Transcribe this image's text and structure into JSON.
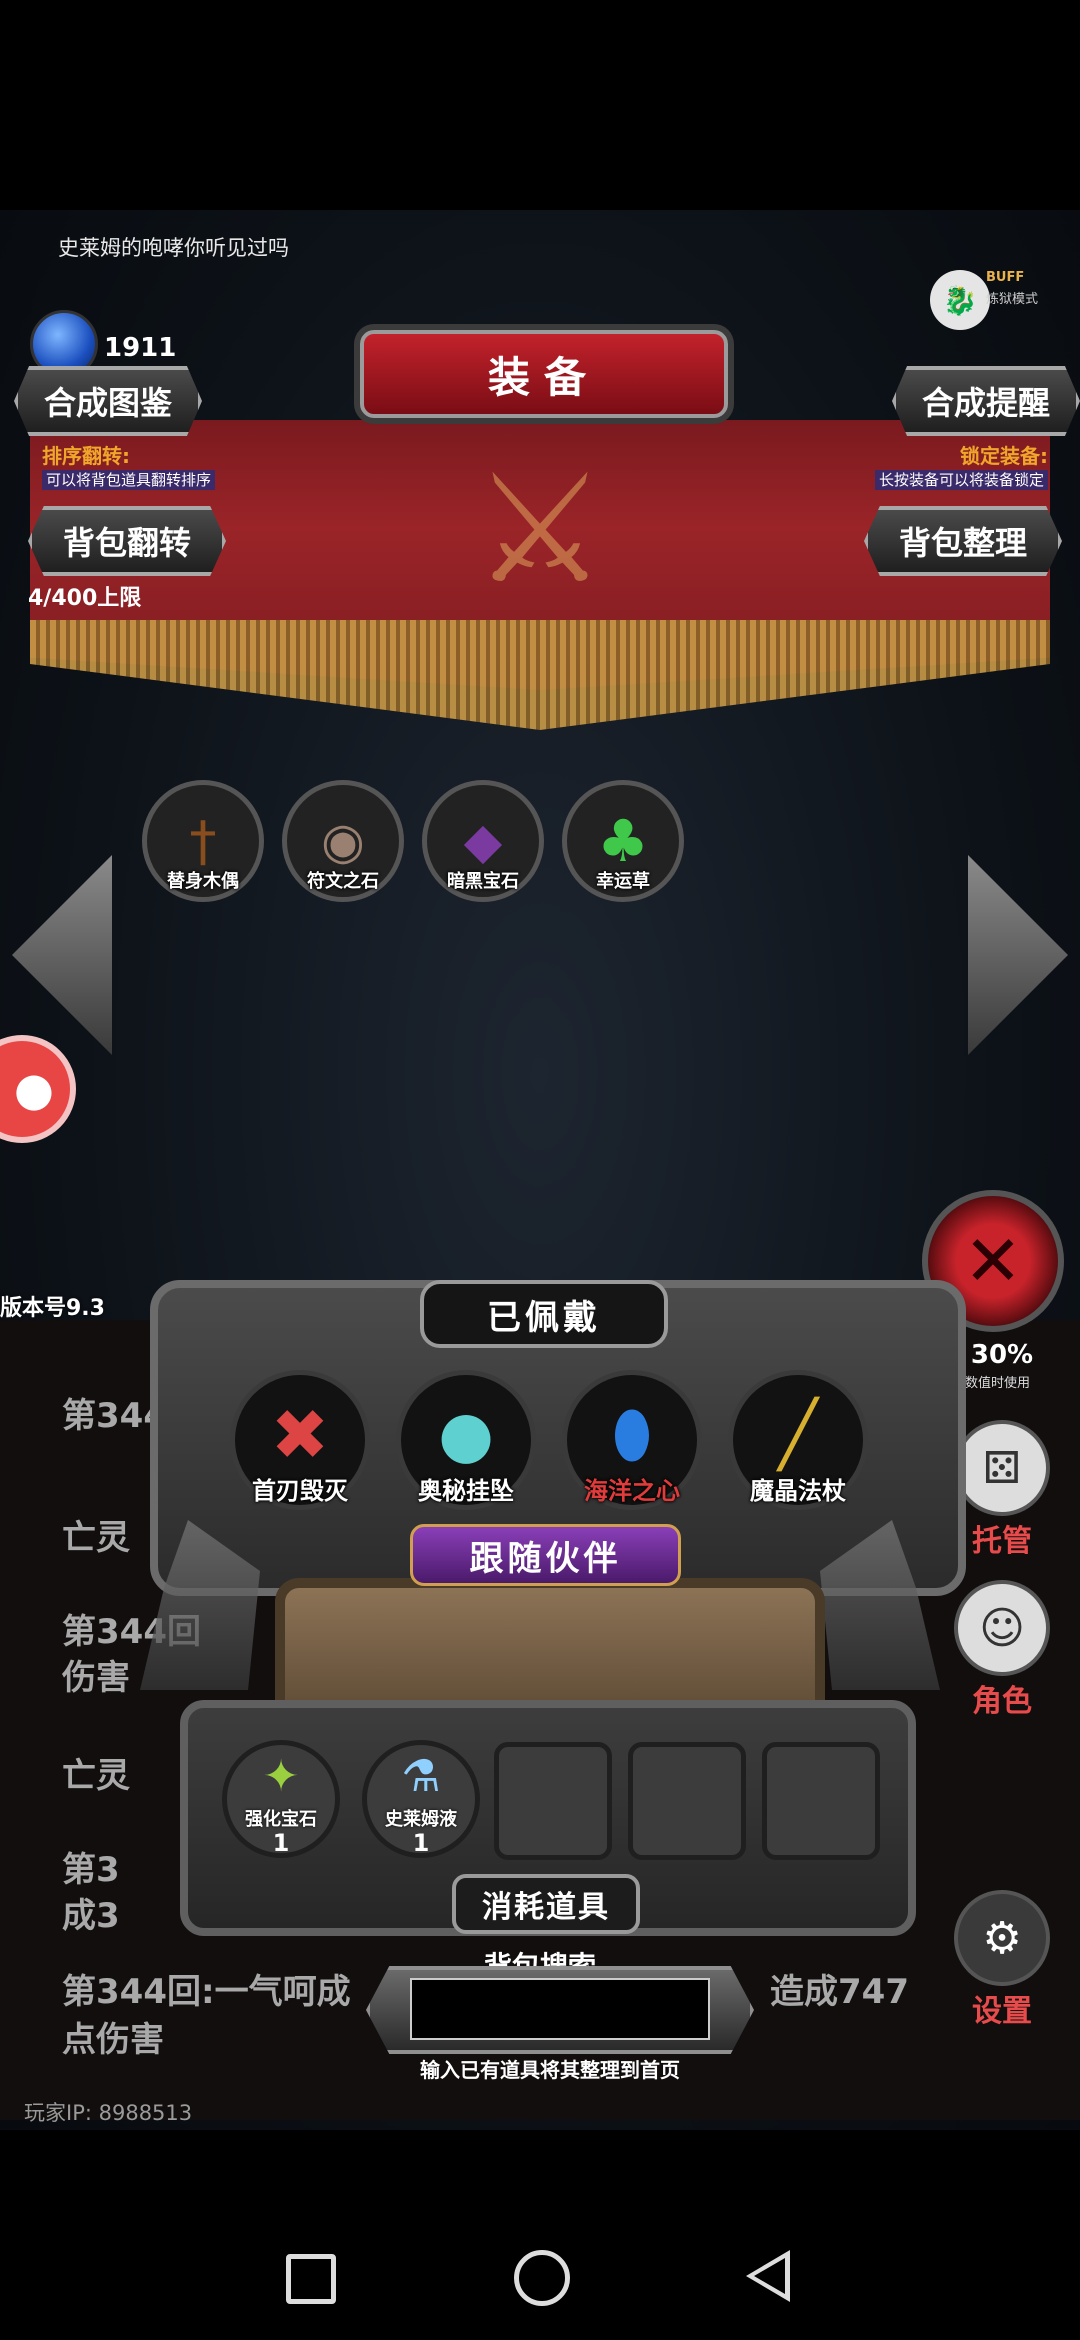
{
  "top_banner": {
    "text": "史莱姆的咆哮你听见过吗"
  },
  "resources": {
    "gem_count": "1911"
  },
  "buff": {
    "label": "BUFF",
    "mode": "炼狱模式"
  },
  "header": {
    "title": "装备"
  },
  "buttons": {
    "synthesis_book": "合成图鉴",
    "synthesis_reminder": "合成提醒",
    "bag_flip": "背包翻转",
    "bag_sort": "背包整理"
  },
  "hints": {
    "sort_flip_title": "排序翻转:",
    "sort_flip_desc": "可以将背包道具翻转排序",
    "lock_equip_title": "锁定装备:",
    "lock_equip_desc": "长按装备可以将装备锁定"
  },
  "capacity": "4/400上限",
  "bag_items": [
    {
      "label": "替身木偶",
      "icon": "wooden-puppet-icon"
    },
    {
      "label": "符文之石",
      "icon": "rune-stone-icon"
    },
    {
      "label": "暗黑宝石",
      "icon": "dark-gem-icon"
    },
    {
      "label": "幸运草",
      "icon": "clover-icon"
    }
  ],
  "version": "版本号9.3",
  "equipped": {
    "title": "已佩戴",
    "items": [
      {
        "label": "首刃毁灭",
        "color": "#ffffff",
        "icon": "blade-icon"
      },
      {
        "label": "奥秘挂坠",
        "color": "#ffffff",
        "icon": "pendant-icon"
      },
      {
        "label": "海洋之心",
        "color": "#e23b3b",
        "icon": "ocean-heart-icon"
      },
      {
        "label": "魔晶法杖",
        "color": "#ffffff",
        "icon": "staff-icon"
      }
    ]
  },
  "companion": {
    "title": "跟随伙伴"
  },
  "consumables": {
    "title": "消耗道具",
    "items": [
      {
        "label": "强化宝石",
        "count": "1",
        "icon": "enhance-gem-icon"
      },
      {
        "label": "史莱姆液",
        "count": "1",
        "icon": "slime-potion-icon"
      }
    ]
  },
  "search": {
    "label": "背包搜索",
    "placeholder": "",
    "hint": "输入已有道具将其整理到首页"
  },
  "side_menu": {
    "percent": "30%",
    "percent_note": "其数值时使用",
    "manage": "托管",
    "role": "角色",
    "settings": "设置"
  },
  "log": {
    "lines": [
      "第344",
      "亡灵",
      "第344回",
      "伤害",
      "亡灵",
      "第3",
      "成3",
      "第344回:一气呵成",
      "造成747",
      "点伤害"
    ],
    "player_ip": "玩家IP: 8988513"
  },
  "colors": {
    "accent_red": "#9a2428",
    "gold": "#f0a62b",
    "highlight_red": "#e23b3b"
  }
}
